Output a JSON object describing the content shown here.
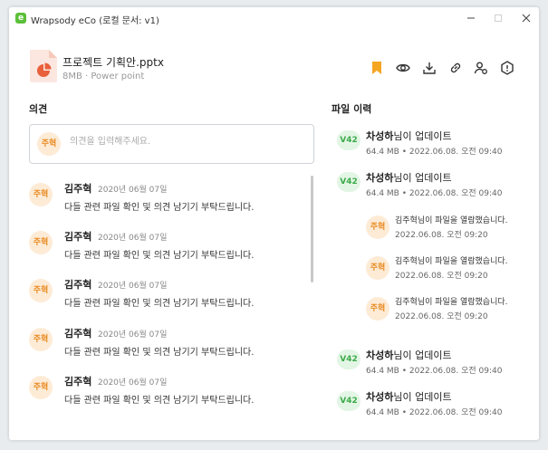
{
  "window": {
    "title": "Wrapsody eCo (로컬 문서: v1)",
    "app_icon_glyph": "e",
    "brand_color": "#5cbf3a"
  },
  "file": {
    "name": "프로젝트 기획안.pptx",
    "meta": "8MB · Power point",
    "icon": "powerpoint-file-icon"
  },
  "toolbar": {
    "icons": [
      "bookmark-icon",
      "view-icon",
      "download-icon",
      "link-icon",
      "share-user-icon",
      "info-icon"
    ],
    "bookmark_color": "#f5a623"
  },
  "comments": {
    "title": "의견",
    "input_avatar": "주혁",
    "placeholder": "의견을 입력해주세요.",
    "items": [
      {
        "avatar": "주혁",
        "name": "김주혁",
        "date": "2020년 06월 07일",
        "text": "다들 관련 파일 확인 및 의견 남기기 부탁드립니다."
      },
      {
        "avatar": "주혁",
        "name": "김주혁",
        "date": "2020년 06월 07일",
        "text": "다들 관련 파일 확인 및 의견 남기기 부탁드립니다."
      },
      {
        "avatar": "주혁",
        "name": "김주혁",
        "date": "2020년 06월 07일",
        "text": "다들 관련 파일 확인 및 의견 남기기 부탁드립니다."
      },
      {
        "avatar": "주혁",
        "name": "김주혁",
        "date": "2020년 06월 07일",
        "text": "다들 관련 파일 확인 및 의견 남기기 부탁드립니다."
      },
      {
        "avatar": "주혁",
        "name": "김주혁",
        "date": "2020년 06월 07일",
        "text": "다들 관련 파일 확인 및 의견 남기기 부탁드립니다."
      }
    ]
  },
  "history": {
    "title": "파일 이력",
    "updates_top": [
      {
        "version": "V42",
        "user": "차성하",
        "suffix": "님이 업데이트",
        "meta": "64.4 MB • 2022.06.08. 오전 09:40"
      },
      {
        "version": "V42",
        "user": "차성하",
        "suffix": "님이 업데이트",
        "meta": "64.4 MB • 2022.06.08. 오전 09:40"
      }
    ],
    "views": [
      {
        "avatar": "주혁",
        "text": "김주혁님이 파일을 열람했습니다.",
        "meta": "2022.06.08. 오전 09:20"
      },
      {
        "avatar": "주혁",
        "text": "김주혁님이 파일을 열람했습니다.",
        "meta": "2022.06.08. 오전 09:20"
      },
      {
        "avatar": "주혁",
        "text": "김주혁님이 파일을 열람했습니다.",
        "meta": "2022.06.08. 오전 09:20"
      }
    ],
    "updates_bottom": [
      {
        "version": "V42",
        "user": "차성하",
        "suffix": "님이 업데이트",
        "meta": "64.4 MB • 2022.06.08. 오전 09:40"
      },
      {
        "version": "V42",
        "user": "차성하",
        "suffix": "님이 업데이트",
        "meta": "64.4 MB • 2022.06.08. 오전 09:40"
      }
    ]
  }
}
